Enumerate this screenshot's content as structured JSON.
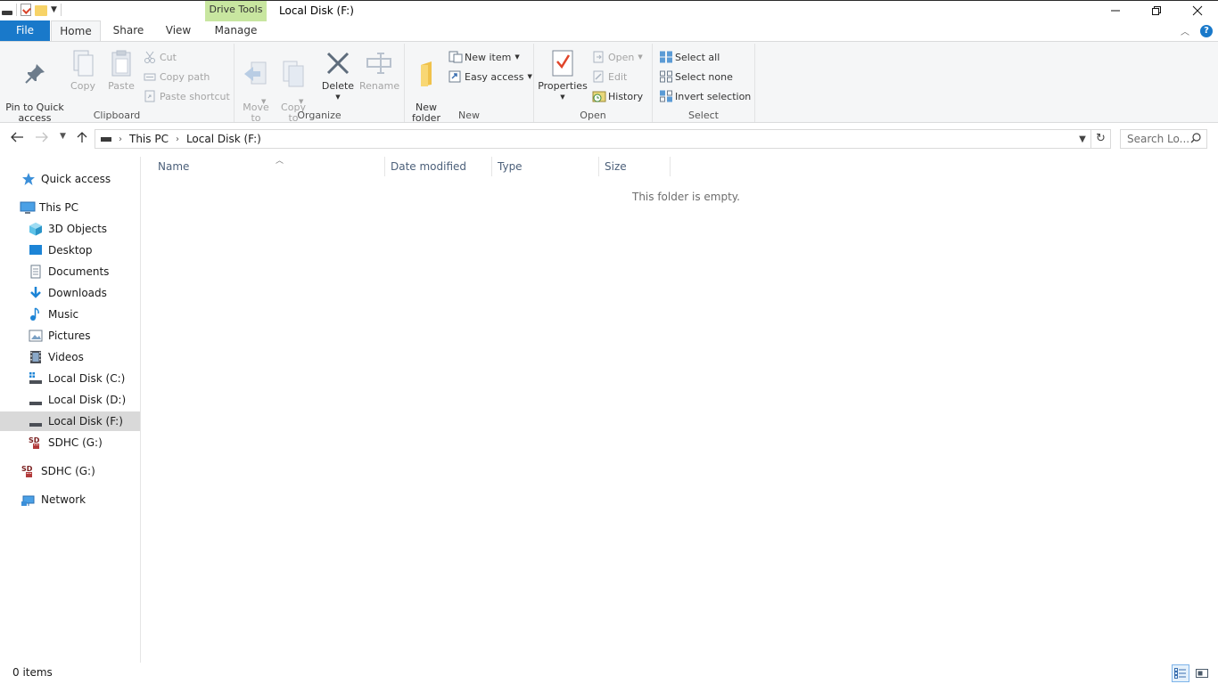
{
  "window": {
    "title": "Local Disk (F:)",
    "context_tab_group": "Drive Tools",
    "controls": [
      "minimize",
      "restore",
      "close"
    ]
  },
  "ribbon_tabs": [
    {
      "label": "File"
    },
    {
      "label": "Home"
    },
    {
      "label": "Share"
    },
    {
      "label": "View"
    },
    {
      "label": "Manage"
    }
  ],
  "help_label": "?",
  "ribbon": {
    "clipboard": {
      "label": "Clipboard",
      "pin": "Pin to Quick\naccess",
      "copy": "Copy",
      "paste": "Paste",
      "cut": "Cut",
      "copy_path": "Copy path",
      "paste_shortcut": "Paste shortcut"
    },
    "organize": {
      "label": "Organize",
      "move_to": "Move\nto",
      "copy_to": "Copy\nto",
      "delete": "Delete",
      "rename": "Rename"
    },
    "new": {
      "label": "New",
      "new_folder": "New\nfolder",
      "new_item": "New item",
      "easy_access": "Easy access"
    },
    "open": {
      "label": "Open",
      "properties": "Properties",
      "open": "Open",
      "edit": "Edit",
      "history": "History"
    },
    "select": {
      "label": "Select",
      "select_all": "Select all",
      "select_none": "Select none",
      "invert_selection": "Invert selection"
    }
  },
  "address": {
    "crumbs": [
      "This PC",
      "Local Disk (F:)"
    ],
    "search_placeholder": "Search Lo..."
  },
  "nav_pane": [
    {
      "label": "Quick access",
      "icon": "star-icon",
      "level": 0
    },
    {
      "label": "This PC",
      "icon": "computer-icon",
      "level": 0
    },
    {
      "label": "3D Objects",
      "icon": "cube-icon",
      "level": 1
    },
    {
      "label": "Desktop",
      "icon": "desktop-icon",
      "level": 1
    },
    {
      "label": "Documents",
      "icon": "document-icon",
      "level": 1
    },
    {
      "label": "Downloads",
      "icon": "download-icon",
      "level": 1
    },
    {
      "label": "Music",
      "icon": "music-icon",
      "level": 1
    },
    {
      "label": "Pictures",
      "icon": "pictures-icon",
      "level": 1
    },
    {
      "label": "Videos",
      "icon": "video-icon",
      "level": 1
    },
    {
      "label": "Local Disk (C:)",
      "icon": "system-drive-icon",
      "level": 1
    },
    {
      "label": "Local Disk (D:)",
      "icon": "drive-icon",
      "level": 1
    },
    {
      "label": "Local Disk (F:)",
      "icon": "drive-icon",
      "level": 1,
      "selected": true
    },
    {
      "label": "SDHC (G:)",
      "icon": "sd-card-icon",
      "level": 1
    },
    {
      "label": "SDHC (G:)",
      "icon": "sd-card-icon",
      "level": 0
    },
    {
      "label": "Network",
      "icon": "network-icon",
      "level": 0
    }
  ],
  "columns": [
    "Name",
    "Date modified",
    "Type",
    "Size"
  ],
  "empty_message": "This folder is empty.",
  "status": {
    "item_count": "0 items"
  },
  "colors": {
    "file_tab": "#1979ca",
    "drive_tools": "#c8e6a0",
    "selected_nav": "#d9d9d9"
  }
}
